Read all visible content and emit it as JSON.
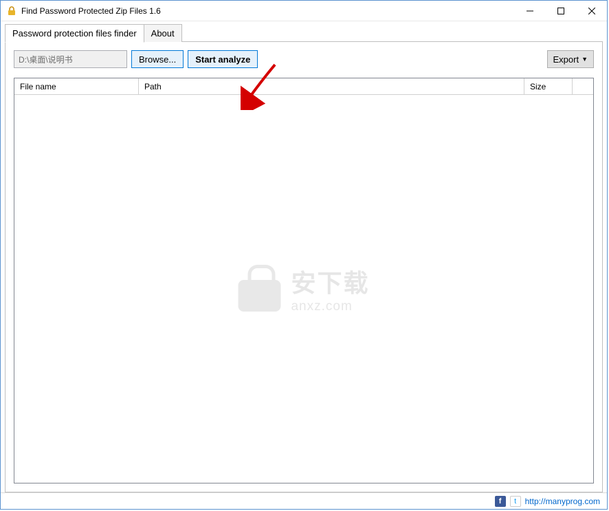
{
  "window": {
    "title": "Find Password Protected Zip Files 1.6"
  },
  "tabs": {
    "main": "Password protection files finder",
    "about": "About"
  },
  "toolbar": {
    "path_value": "D:\\桌面\\说明书",
    "browse_label": "Browse...",
    "analyze_label": "Start analyze",
    "export_label": "Export"
  },
  "grid": {
    "columns": {
      "filename": "File name",
      "path": "Path",
      "size": "Size"
    }
  },
  "watermark": {
    "cn": "安下载",
    "en": "anxz.com"
  },
  "statusbar": {
    "url": "http://manyprog.com"
  }
}
